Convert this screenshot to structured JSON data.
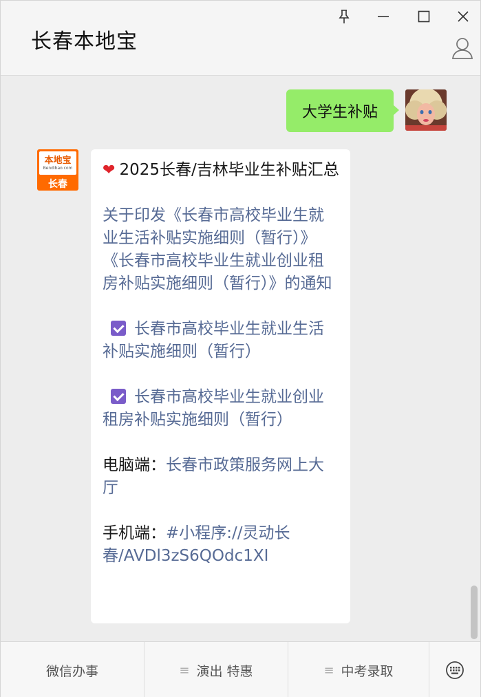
{
  "window": {
    "title": "长春本地宝"
  },
  "chat": {
    "user_message": "大学生补贴",
    "bot_avatar": {
      "logo_text": "本地宝",
      "logo_subtext": "Bendibao.com",
      "city": "长春"
    },
    "reply": {
      "heading": "2025长春/吉林毕业生补贴汇总",
      "notice_link": "关于印发《长春市高校毕业生就业生活补贴实施细则（暂行）》《长春市高校毕业生就业创业租房补贴实施细则（暂行）》的通知",
      "item1": "长春市高校毕业生就业生活补贴实施细则（暂行）",
      "item2": "长春市高校毕业生就业创业租房补贴实施细则（暂行）",
      "pc_label": "电脑端：",
      "pc_link": "长春市政策服务网上大厅",
      "mobile_label": "手机端：",
      "mobile_link": "#小程序://灵动长春/AVDl3zS6QOdc1XI"
    }
  },
  "menu": {
    "items": [
      "微信办事",
      "演出 特惠",
      "中考录取"
    ]
  },
  "colors": {
    "user_bubble": "#95ec69",
    "link": "#576b95",
    "check": "#7a5cc9"
  }
}
